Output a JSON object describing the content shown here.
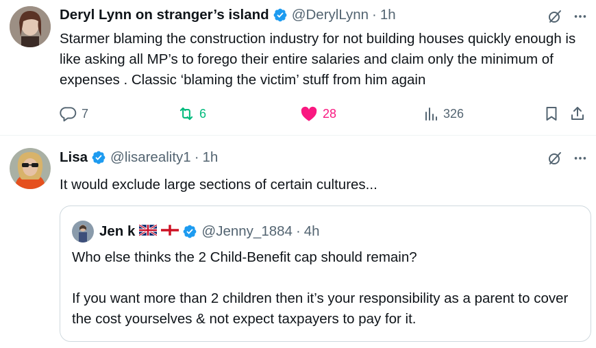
{
  "posts": [
    {
      "author_name": "Deryl Lynn on stranger’s island",
      "handle": "@DerylLynn",
      "separator": "·",
      "time": "1h",
      "text": "Starmer blaming the construction industry for not building houses quickly enough is like asking all MP’s to forego their entire salaries and claim only the minimum of expenses . Classic ‘blaming the victim’ stuff from him again",
      "replies": "7",
      "reposts": "6",
      "likes": "28",
      "views": "326",
      "icons": [
        "verified-badge-icon",
        "grok-icon",
        "more-icon",
        "reply-icon",
        "repost-icon",
        "heart-icon",
        "views-icon",
        "bookmark-icon",
        "share-icon"
      ]
    },
    {
      "author_name": "Lisa",
      "handle": "@lisareality1",
      "separator": "·",
      "time": "1h",
      "text": "It would exclude large sections of certain cultures...",
      "icons": [
        "verified-badge-icon",
        "grok-icon",
        "more-icon"
      ],
      "quote": {
        "author_name": "Jen k",
        "handle": "@Jenny_1884",
        "separator": "·",
        "time": "4h",
        "paragraph1": "Who else thinks the 2 Child-Benefit cap should remain?",
        "paragraph2": "If you want more than 2 children then it’s your responsibility as a parent to cover the cost yourselves & not expect taxpayers to pay for it.",
        "icons": [
          "uk-flag-icon",
          "england-flag-icon",
          "verified-badge-icon"
        ]
      }
    }
  ],
  "colors": {
    "text": "#0f1419",
    "secondary": "#536471",
    "verified": "#1d9bf0",
    "repost": "#00ba7c",
    "like": "#f91880",
    "border": "#cfd9de"
  }
}
